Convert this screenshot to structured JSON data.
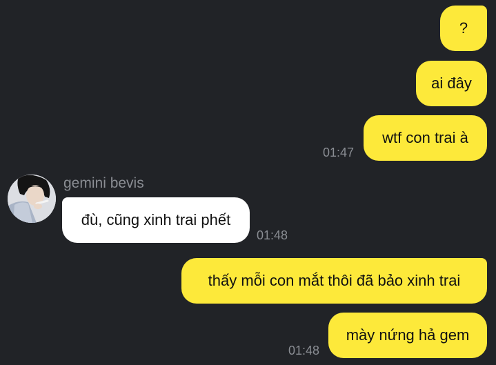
{
  "conversation": {
    "messages": [
      {
        "id": "m1",
        "direction": "outgoing",
        "text": "?"
      },
      {
        "id": "m2",
        "direction": "outgoing",
        "text": "ai đây"
      },
      {
        "id": "m3",
        "direction": "outgoing",
        "text": "wtf con trai à",
        "time": "01:47"
      },
      {
        "id": "m4",
        "direction": "incoming",
        "sender": "gemini bevis",
        "text": "đù, cũng xinh trai phết",
        "time": "01:48"
      },
      {
        "id": "m5",
        "direction": "outgoing",
        "text": "thấy mỗi con mắt thôi đã bảo xinh trai"
      },
      {
        "id": "m6",
        "direction": "outgoing",
        "text": "mày nứng hả gem",
        "time": "01:48"
      }
    ]
  },
  "colors": {
    "background": "#212327",
    "outgoing_bubble": "#fde93a",
    "incoming_bubble": "#ffffff",
    "timestamp": "#8a8d93"
  }
}
